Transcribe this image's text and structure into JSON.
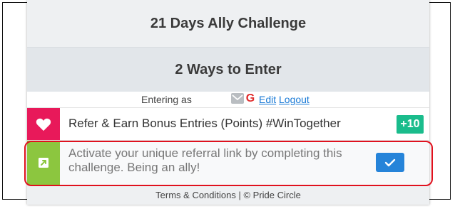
{
  "widget": {
    "title": "21 Days Ally Challenge",
    "ways_heading": "2 Ways to Enter",
    "entering_as_label": "Entering as",
    "edit_label": "Edit",
    "logout_label": "Logout",
    "google_initial": "G"
  },
  "entries": [
    {
      "icon": "heart-icon",
      "text": "Refer & Earn Bonus Entries (Points) #WinTogether",
      "badge": "+10",
      "color": "#e8195a"
    },
    {
      "icon": "external-link-icon",
      "text": "Activate your unique referral link by completing this challenge. Being an ally!",
      "color": "#8cc63f",
      "action": "check-icon"
    }
  ],
  "footer": {
    "text": "Terms & Conditions | © Pride Circle"
  },
  "colors": {
    "highlight": "#e0111e",
    "points": "#1abc8c",
    "check_button": "#2684d9",
    "link": "#1a7ad6"
  }
}
